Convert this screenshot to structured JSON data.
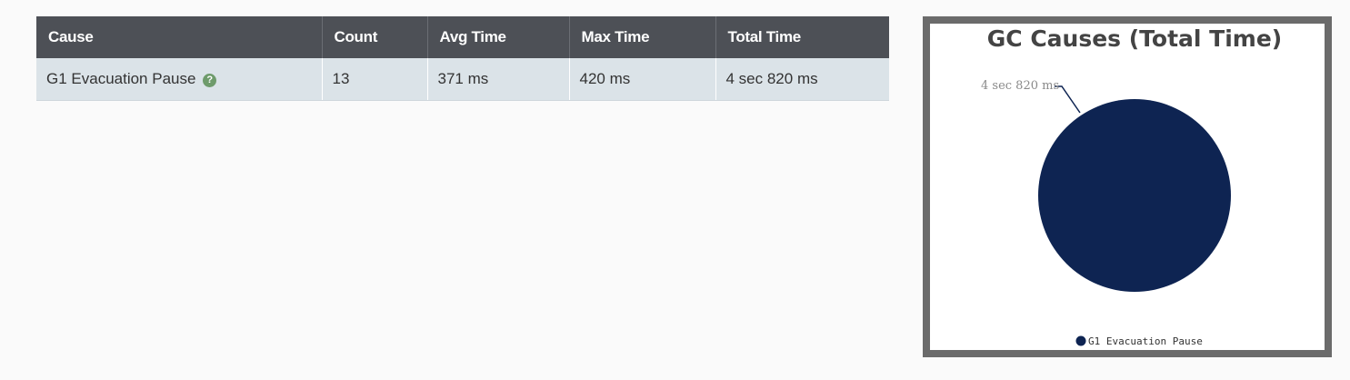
{
  "table": {
    "headers": {
      "cause": "Cause",
      "count": "Count",
      "avg_time": "Avg Time",
      "max_time": "Max Time",
      "total_time": "Total Time"
    },
    "rows": [
      {
        "cause": "G1 Evacuation Pause",
        "help_icon": "question-circle-icon",
        "help_glyph": "?",
        "count": "13",
        "avg_time": "371 ms",
        "max_time": "420 ms",
        "total_time": "4 sec 820 ms"
      }
    ]
  },
  "colors": {
    "header_bg": "#4d5056",
    "row_bg": "#dbe3e8",
    "help_icon": "#6e9b6b",
    "slice": "#0e2452",
    "frame": "#6b6b6b"
  },
  "chart_data": {
    "type": "pie",
    "title": "GC Causes (Total Time)",
    "categories": [
      "G1 Evacuation Pause"
    ],
    "values": [
      4820
    ],
    "slice_labels": [
      "4 sec 820 ms"
    ],
    "legend": [
      "G1 Evacuation Pause"
    ],
    "legend_position": "bottom",
    "colors": [
      "#0e2452"
    ]
  }
}
